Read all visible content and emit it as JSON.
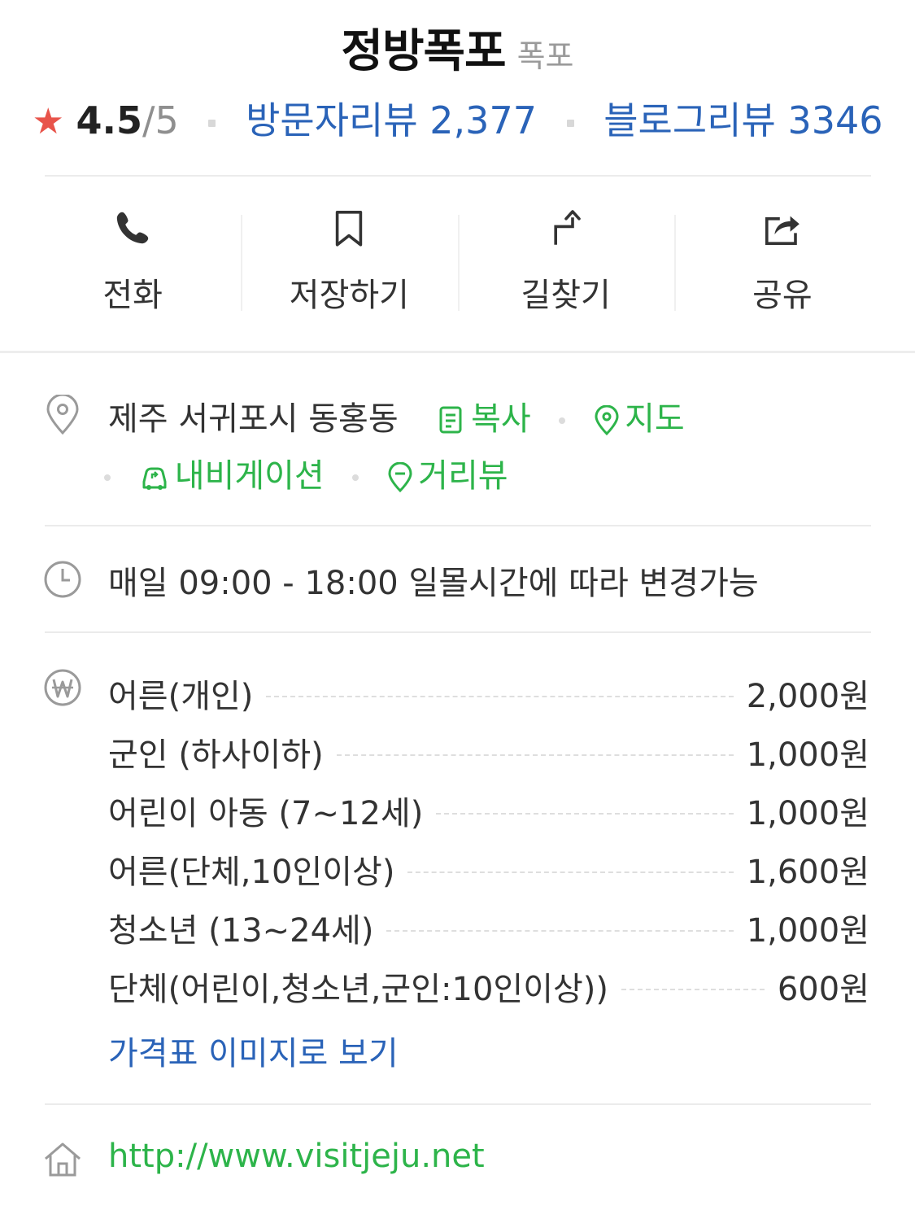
{
  "header": {
    "title": "정방폭포",
    "category": "폭포"
  },
  "rating": {
    "star": "★",
    "score": "4.5",
    "max": "/5",
    "visitor_reviews": "방문자리뷰 2,377",
    "blog_reviews": "블로그리뷰 3346"
  },
  "actions": [
    {
      "label": "전화",
      "icon": "phone-icon"
    },
    {
      "label": "저장하기",
      "icon": "bookmark-icon"
    },
    {
      "label": "길찾기",
      "icon": "directions-icon"
    },
    {
      "label": "공유",
      "icon": "share-icon"
    }
  ],
  "address": {
    "text": "제주 서귀포시 동홍동",
    "copy": "복사",
    "map": "지도",
    "navigation": "내비게이션",
    "street_view": "거리뷰"
  },
  "hours": {
    "text": "매일 09:00 - 18:00 일몰시간에 따라 변경가능"
  },
  "prices": [
    {
      "name": "어른(개인)",
      "value": "2,000원"
    },
    {
      "name": "군인 (하사이하)",
      "value": "1,000원"
    },
    {
      "name": "어린이 아동 (7~12세)",
      "value": "1,000원"
    },
    {
      "name": "어른(단체,10인이상)",
      "value": "1,600원"
    },
    {
      "name": "청소년 (13~24세)",
      "value": "1,000원"
    },
    {
      "name": "단체(어린이,청소년,군인:10인이상))",
      "value": "600원"
    }
  ],
  "price_image_link": "가격표 이미지로 보기",
  "homepage": "http://www.visitjeju.net",
  "colors": {
    "star": "#e8534a",
    "link_blue": "#2a63b8",
    "link_green": "#2db44a"
  }
}
